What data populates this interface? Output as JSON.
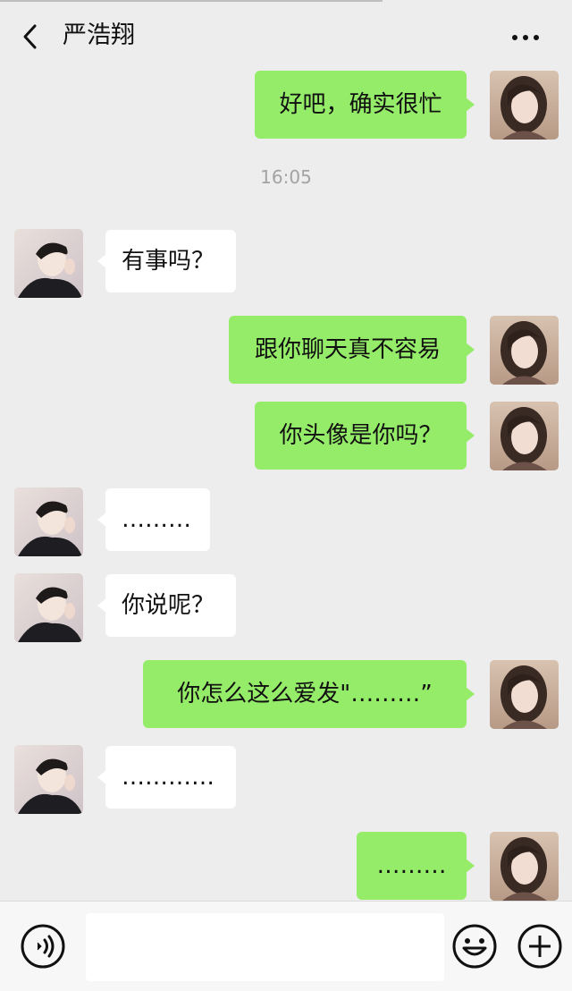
{
  "header": {
    "title": "严浩翔"
  },
  "messages": [
    {
      "from": "me",
      "text": "好吧，确实很忙"
    },
    {
      "type": "time",
      "text": "16:05"
    },
    {
      "from": "contact",
      "text": "有事吗？"
    },
    {
      "from": "me",
      "text": "跟你聊天真不容易"
    },
    {
      "from": "me",
      "text": "你头像是你吗？"
    },
    {
      "from": "contact",
      "text": "………"
    },
    {
      "from": "contact",
      "text": "你说呢？"
    },
    {
      "from": "me",
      "text": "你怎么这么爱发\"………”"
    },
    {
      "from": "contact",
      "text": "…………"
    },
    {
      "from": "me",
      "text": "………"
    }
  ],
  "input": {
    "value": ""
  },
  "icons": {
    "back": "chevron-left-icon",
    "more": "more-dots-icon",
    "voice": "voice-icon",
    "emoji": "emoji-icon",
    "plus": "plus-icon"
  },
  "colors": {
    "outgoing_bubble": "#95ec69",
    "incoming_bubble": "#ffffff",
    "background": "#ededed"
  }
}
